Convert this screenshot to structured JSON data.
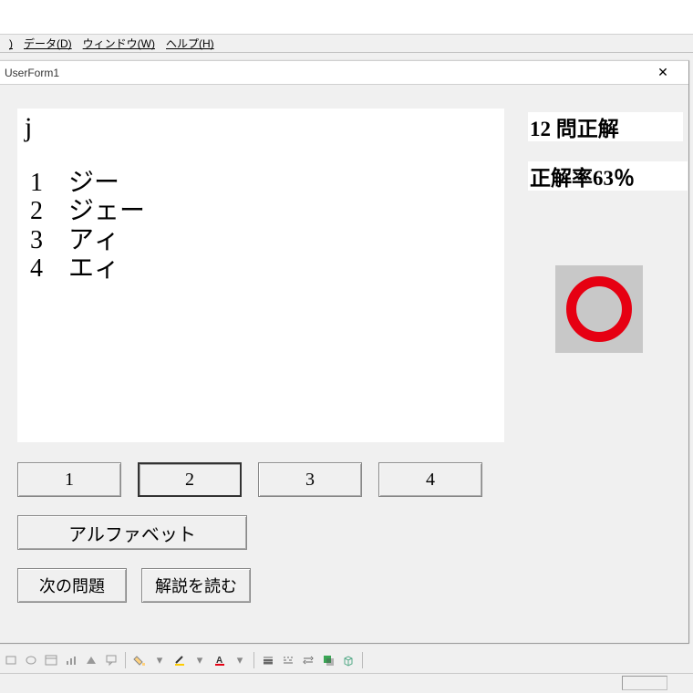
{
  "menu": {
    "partial": ")",
    "data": "データ(D)",
    "window": "ウィンドウ(W)",
    "help": "ヘルプ(H)"
  },
  "form": {
    "title": "UserForm1"
  },
  "question": {
    "prompt": "j",
    "choices": [
      {
        "num": "1",
        "text": "ジー"
      },
      {
        "num": "2",
        "text": "ジェー"
      },
      {
        "num": "3",
        "text": "アィ"
      },
      {
        "num": "4",
        "text": "エィ"
      }
    ]
  },
  "score": {
    "correct_line": "12 問正解",
    "rate_line": "正解率63％"
  },
  "answer_buttons": [
    "1",
    "2",
    "3",
    "4"
  ],
  "selected_answer": "2",
  "alpha_button": "アルファベット",
  "next_button": "次の問題",
  "explain_button": "解説を読む",
  "result_mark": "correct"
}
